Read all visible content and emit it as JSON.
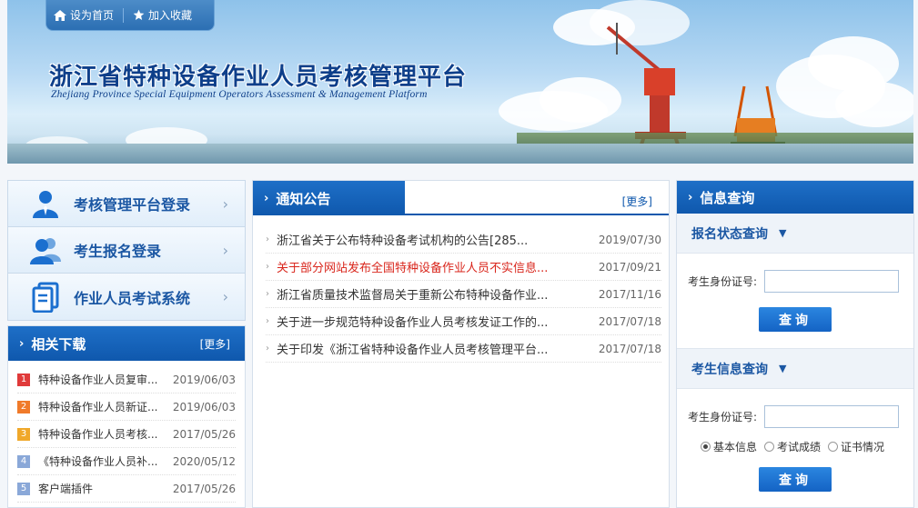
{
  "header": {
    "set_home": "设为首页",
    "add_favorite": "加入收藏",
    "title": "浙江省特种设备作业人员考核管理平台",
    "subtitle": "Zhejiang Province Special Equipment Operators Assessment & Management Platform"
  },
  "login": {
    "items": [
      {
        "label": "考核管理平台登录",
        "icon": "user-icon"
      },
      {
        "label": "考生报名登录",
        "icon": "users-icon"
      },
      {
        "label": "作业人员考试系统",
        "icon": "documents-icon"
      }
    ]
  },
  "downloads": {
    "title": "相关下载",
    "more": "[更多]",
    "items": [
      {
        "num": "1",
        "name": "特种设备作业人员复审...",
        "date": "2019/06/03",
        "color": "#e03a3a"
      },
      {
        "num": "2",
        "name": "特种设备作业人员新证...",
        "date": "2019/06/03",
        "color": "#f07a2a"
      },
      {
        "num": "3",
        "name": "特种设备作业人员考核...",
        "date": "2017/05/26",
        "color": "#f0a82a"
      },
      {
        "num": "4",
        "name": "《特种设备作业人员补...",
        "date": "2020/05/12",
        "color": "#8aa8d8"
      },
      {
        "num": "5",
        "name": "客户端插件",
        "date": "2017/05/26",
        "color": "#8aa8d8"
      }
    ]
  },
  "notices": {
    "title": "通知公告",
    "more": "[更多]",
    "items": [
      {
        "text": "浙江省关于公布特种设备考试机构的公告[285...",
        "date": "2019/07/30",
        "highlight": false
      },
      {
        "text": "关于部分网站发布全国特种设备作业人员不实信息...",
        "date": "2017/09/21",
        "highlight": true
      },
      {
        "text": "浙江省质量技术监督局关于重新公布特种设备作业...",
        "date": "2017/11/16",
        "highlight": false
      },
      {
        "text": "关于进一步规范特种设备作业人员考核发证工作的...",
        "date": "2017/07/18",
        "highlight": false
      },
      {
        "text": "关于印发《浙江省特种设备作业人员考核管理平台...",
        "date": "2017/07/18",
        "highlight": false
      }
    ]
  },
  "query": {
    "title": "信息查询",
    "status_title": "报名状态查询",
    "status_id_label": "考生身份证号:",
    "status_button": "查询",
    "info_title": "考生信息查询",
    "info_id_label": "考生身份证号:",
    "options": [
      "基本信息",
      "考试成绩",
      "证书情况"
    ],
    "selected_option": "基本信息",
    "info_button": "查询"
  }
}
